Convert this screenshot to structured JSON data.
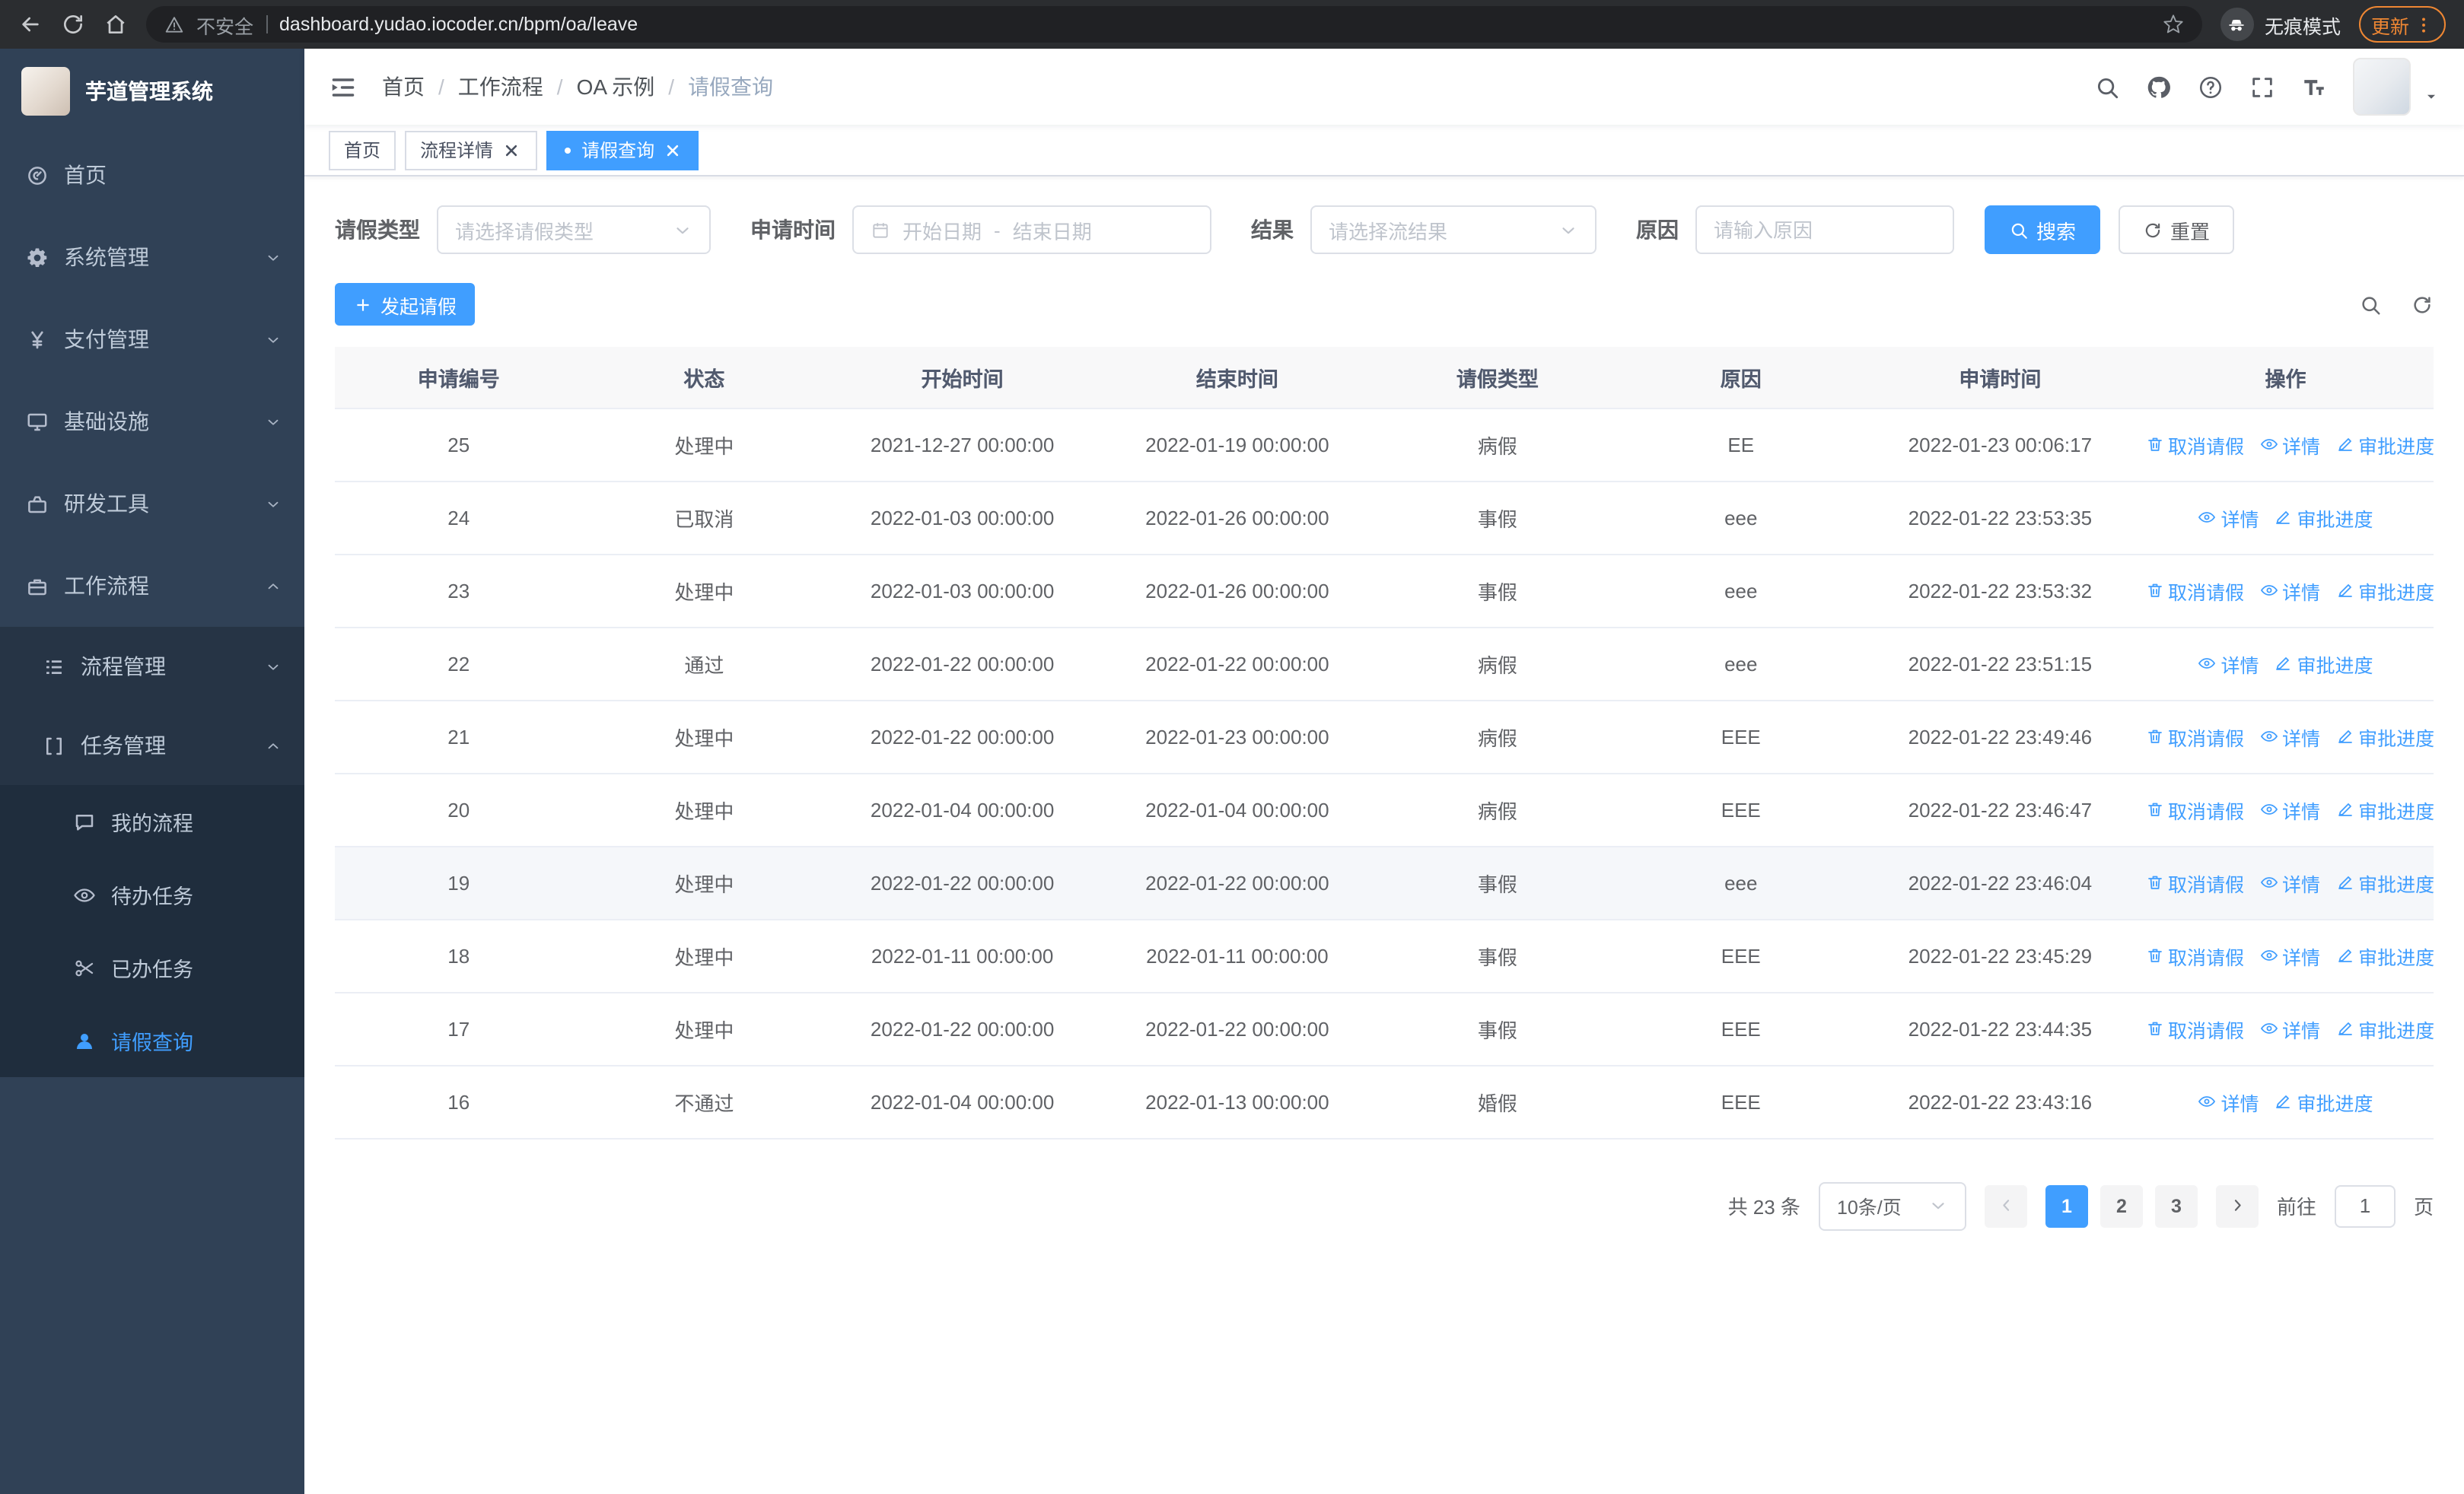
{
  "browser": {
    "security_label": "不安全",
    "url": "dashboard.yudao.iocoder.cn/bpm/oa/leave",
    "incognito_label": "无痕模式",
    "update_label": "更新"
  },
  "sidebar": {
    "logo_title": "芋道管理系统",
    "items": [
      {
        "key": "home",
        "label": "首页",
        "icon": "dashboard",
        "level": 1,
        "arrow": null,
        "active": false
      },
      {
        "key": "system",
        "label": "系统管理",
        "icon": "gear",
        "level": 1,
        "arrow": "down",
        "active": false
      },
      {
        "key": "payment",
        "label": "支付管理",
        "icon": "yen",
        "level": 1,
        "arrow": "down",
        "active": false
      },
      {
        "key": "infrastructure",
        "label": "基础设施",
        "icon": "infra",
        "level": 1,
        "arrow": "down",
        "active": false
      },
      {
        "key": "devtools",
        "label": "研发工具",
        "icon": "tools",
        "level": 1,
        "arrow": "down",
        "active": false
      },
      {
        "key": "workflow",
        "label": "工作流程",
        "icon": "workflow",
        "level": 1,
        "arrow": "up",
        "active": false
      },
      {
        "key": "process-mgmt",
        "label": "流程管理",
        "icon": "process",
        "level": 2,
        "arrow": "down",
        "active": false
      },
      {
        "key": "task-mgmt",
        "label": "任务管理",
        "icon": "task",
        "level": 2,
        "arrow": "up",
        "active": false
      },
      {
        "key": "my-process",
        "label": "我的流程",
        "icon": "chat",
        "level": 3,
        "arrow": null,
        "active": false
      },
      {
        "key": "todo-tasks",
        "label": "待办任务",
        "icon": "eye",
        "level": 3,
        "arrow": null,
        "active": false
      },
      {
        "key": "done-tasks",
        "label": "已办任务",
        "icon": "scissors",
        "level": 3,
        "arrow": null,
        "active": false
      },
      {
        "key": "leave-query",
        "label": "请假查询",
        "icon": "person",
        "level": 3,
        "arrow": null,
        "active": true
      }
    ]
  },
  "header": {
    "breadcrumb": [
      "首页",
      "工作流程",
      "OA 示例",
      "请假查询"
    ]
  },
  "tabs": [
    {
      "key": "home",
      "label": "首页",
      "closable": false,
      "active": false
    },
    {
      "key": "process-detail",
      "label": "流程详情",
      "closable": true,
      "active": false
    },
    {
      "key": "leave-query",
      "label": "请假查询",
      "closable": true,
      "active": true
    }
  ],
  "filters": {
    "leave_type_label": "请假类型",
    "leave_type_placeholder": "请选择请假类型",
    "apply_time_label": "申请时间",
    "start_placeholder": "开始日期",
    "range_separator": "-",
    "end_placeholder": "结束日期",
    "result_label": "结果",
    "result_placeholder": "请选择流结果",
    "reason_label": "原因",
    "reason_placeholder": "请输入原因",
    "search_label": "搜索",
    "reset_label": "重置"
  },
  "toolbar": {
    "create_label": "发起请假"
  },
  "table": {
    "columns": [
      "申请编号",
      "状态",
      "开始时间",
      "结束时间",
      "请假类型",
      "原因",
      "申请时间",
      "操作"
    ],
    "action_labels": {
      "cancel": "取消请假",
      "detail": "详情",
      "progress": "审批进度"
    },
    "rows": [
      {
        "id": "25",
        "status": "处理中",
        "start_time": "2021-12-27 00:00:00",
        "end_time": "2022-01-19 00:00:00",
        "leave_type": "病假",
        "reason": "EE",
        "apply_time": "2022-01-23 00:06:17",
        "cancellable": true,
        "highlighted": false
      },
      {
        "id": "24",
        "status": "已取消",
        "start_time": "2022-01-03 00:00:00",
        "end_time": "2022-01-26 00:00:00",
        "leave_type": "事假",
        "reason": "eee",
        "apply_time": "2022-01-22 23:53:35",
        "cancellable": false,
        "highlighted": false
      },
      {
        "id": "23",
        "status": "处理中",
        "start_time": "2022-01-03 00:00:00",
        "end_time": "2022-01-26 00:00:00",
        "leave_type": "事假",
        "reason": "eee",
        "apply_time": "2022-01-22 23:53:32",
        "cancellable": true,
        "highlighted": false
      },
      {
        "id": "22",
        "status": "通过",
        "start_time": "2022-01-22 00:00:00",
        "end_time": "2022-01-22 00:00:00",
        "leave_type": "病假",
        "reason": "eee",
        "apply_time": "2022-01-22 23:51:15",
        "cancellable": false,
        "highlighted": false
      },
      {
        "id": "21",
        "status": "处理中",
        "start_time": "2022-01-22 00:00:00",
        "end_time": "2022-01-23 00:00:00",
        "leave_type": "病假",
        "reason": "EEE",
        "apply_time": "2022-01-22 23:49:46",
        "cancellable": true,
        "highlighted": false
      },
      {
        "id": "20",
        "status": "处理中",
        "start_time": "2022-01-04 00:00:00",
        "end_time": "2022-01-04 00:00:00",
        "leave_type": "病假",
        "reason": "EEE",
        "apply_time": "2022-01-22 23:46:47",
        "cancellable": true,
        "highlighted": false
      },
      {
        "id": "19",
        "status": "处理中",
        "start_time": "2022-01-22 00:00:00",
        "end_time": "2022-01-22 00:00:00",
        "leave_type": "事假",
        "reason": "eee",
        "apply_time": "2022-01-22 23:46:04",
        "cancellable": true,
        "highlighted": true
      },
      {
        "id": "18",
        "status": "处理中",
        "start_time": "2022-01-11 00:00:00",
        "end_time": "2022-01-11 00:00:00",
        "leave_type": "事假",
        "reason": "EEE",
        "apply_time": "2022-01-22 23:45:29",
        "cancellable": true,
        "highlighted": false
      },
      {
        "id": "17",
        "status": "处理中",
        "start_time": "2022-01-22 00:00:00",
        "end_time": "2022-01-22 00:00:00",
        "leave_type": "事假",
        "reason": "EEE",
        "apply_time": "2022-01-22 23:44:35",
        "cancellable": true,
        "highlighted": false
      },
      {
        "id": "16",
        "status": "不通过",
        "start_time": "2022-01-04 00:00:00",
        "end_time": "2022-01-13 00:00:00",
        "leave_type": "婚假",
        "reason": "EEE",
        "apply_time": "2022-01-22 23:43:16",
        "cancellable": false,
        "highlighted": false
      }
    ]
  },
  "pagination": {
    "total_text": "共 23 条",
    "page_size_label": "10条/页",
    "pages": [
      "1",
      "2",
      "3"
    ],
    "active_page": "1",
    "goto_label": "前往",
    "goto_value": "1",
    "goto_unit": "页"
  },
  "colors": {
    "accent": "#409EFF",
    "sidebar_bg": "#304156",
    "sidebar_submenu_bg": "#1f2d3d",
    "update_badge": "#ef8733"
  }
}
